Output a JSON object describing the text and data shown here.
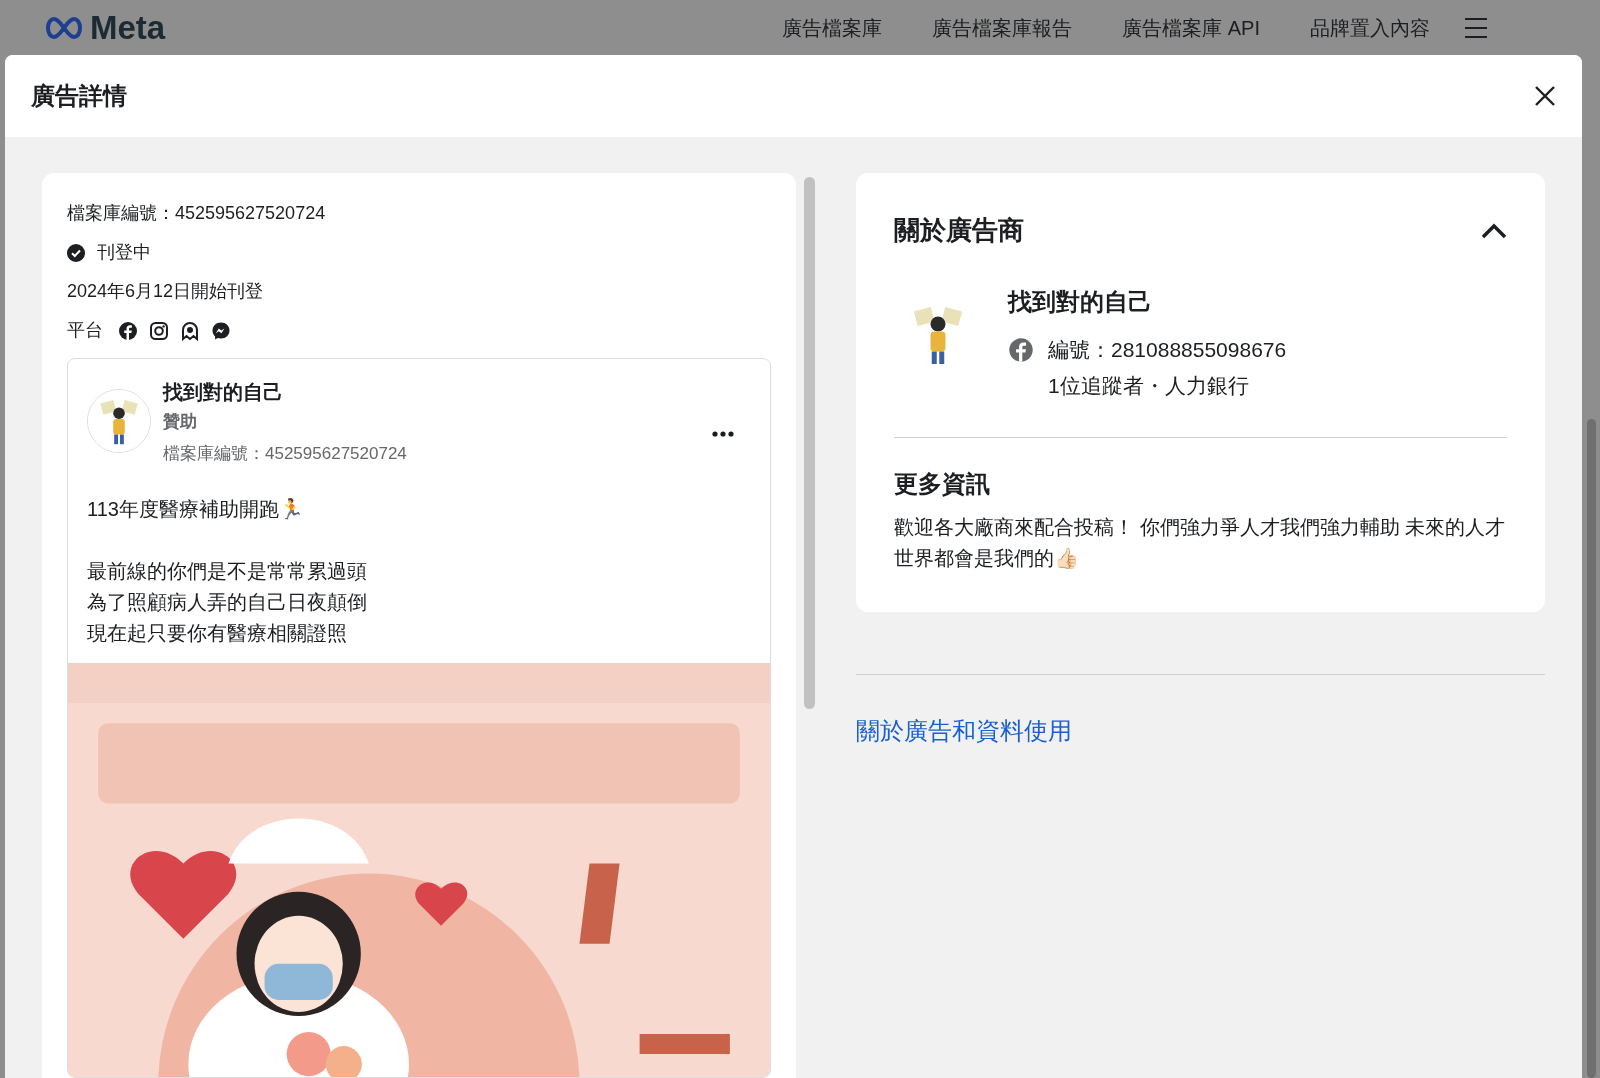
{
  "top_nav": {
    "logo": "Meta",
    "links": [
      "廣告檔案庫",
      "廣告檔案庫報告",
      "廣告檔案庫 API",
      "品牌置入內容"
    ]
  },
  "dialog": {
    "title": "廣告詳情"
  },
  "ad_summary": {
    "library_id": "檔案庫編號：452595627520724",
    "status": "刊登中",
    "active": true,
    "start_date": "2024年6月12日開始刊登",
    "platform_label": "平台",
    "platforms": [
      {
        "kind": "facebook"
      },
      {
        "kind": "instagram"
      },
      {
        "kind": "audience_network"
      },
      {
        "kind": "messenger"
      }
    ]
  },
  "ad_preview": {
    "page_name": "找到對的自己",
    "sponsored": "贊助",
    "library_id": "檔案庫編號：452595627520724",
    "body": [
      [
        "113年度醫療補助開跑🏃"
      ],
      [
        "最前線的你們是不是常常累過頭",
        "為了照顧病人弄的自己日夜顛倒",
        "現在起只要你有醫療相關證照"
      ]
    ],
    "media": {
      "kind": "picture"
    }
  },
  "advertiser": {
    "title": "關於廣告商",
    "expanded": true,
    "name": "找到對的自己",
    "page_id": "編號：281088855098676",
    "details": "1位追蹤者・人力銀行",
    "more_info_title": "更多資訊",
    "more_info": "歡迎各大廠商來配合投稿！ 你們強力爭人才我們強力輔助 未來的人才世界都會是我們的👍🏻"
  },
  "footer_link": "關於廣告和資料使用"
}
